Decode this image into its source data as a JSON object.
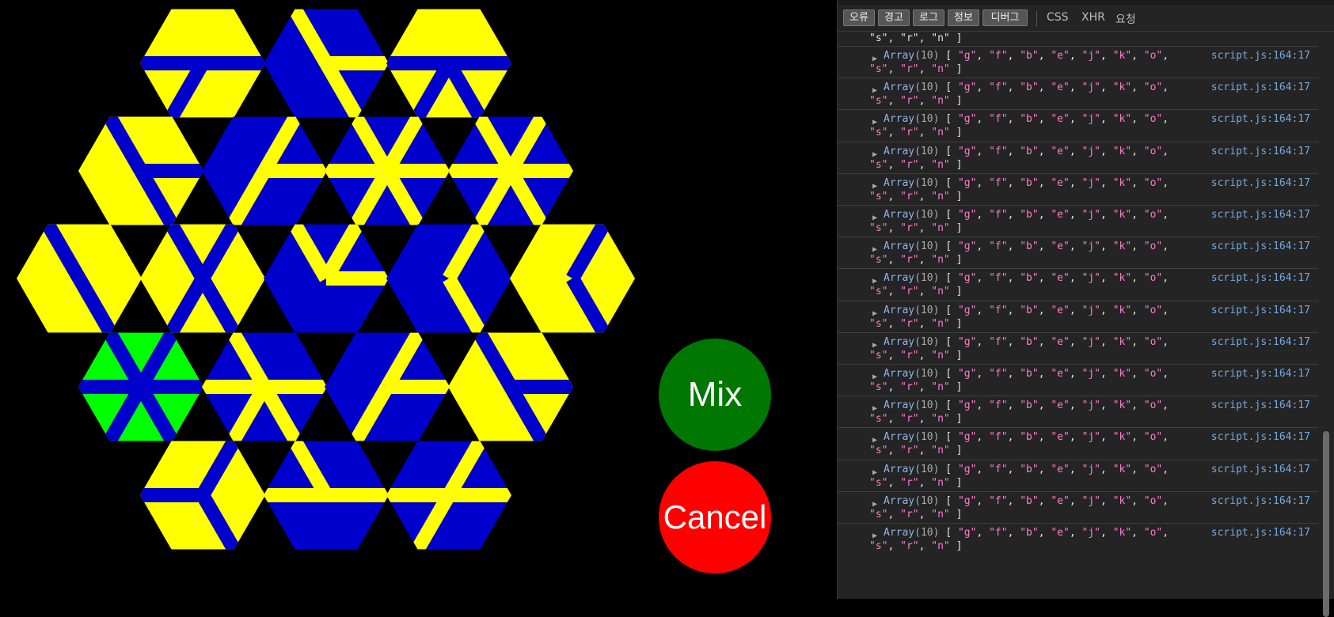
{
  "colors": {
    "background": "#000000",
    "yellow": "#ffff00",
    "blue": "#0000cc",
    "green": "#00ff00",
    "mix_button": "#007700",
    "cancel_button": "#ff0000"
  },
  "game": {
    "mix_label": "Mix",
    "cancel_label": "Cancel",
    "tiles": [
      {
        "id": "t1",
        "bg": "yellow",
        "fg": "blue",
        "arms": [
          1,
          3,
          4
        ]
      },
      {
        "id": "t2",
        "bg": "blue",
        "fg": "yellow",
        "arms": [
          1,
          2,
          5
        ]
      },
      {
        "id": "t3",
        "bg": "yellow",
        "fg": "blue",
        "arms": [
          1,
          2,
          3,
          4
        ]
      },
      {
        "id": "t4",
        "bg": "yellow",
        "fg": "blue",
        "arms": [
          1,
          2,
          5
        ]
      },
      {
        "id": "t5",
        "bg": "blue",
        "fg": "yellow",
        "arms": [
          0,
          1,
          3
        ]
      },
      {
        "id": "t6",
        "bg": "blue",
        "fg": "yellow",
        "arms": [
          0,
          1,
          2,
          3,
          4,
          5
        ]
      },
      {
        "id": "t7",
        "bg": "blue",
        "fg": "yellow",
        "arms": [
          0,
          1,
          2,
          3,
          4,
          5
        ]
      },
      {
        "id": "t8",
        "bg": "yellow",
        "fg": "blue",
        "arms": [
          2,
          5
        ]
      },
      {
        "id": "t9",
        "bg": "yellow",
        "fg": "blue",
        "arms": [
          0,
          2,
          3,
          5
        ]
      },
      {
        "id": "t10",
        "bg": "blue",
        "fg": "yellow",
        "arms": [
          0,
          1,
          5
        ]
      },
      {
        "id": "t11",
        "bg": "blue",
        "fg": "yellow",
        "arms": [
          0,
          2
        ]
      },
      {
        "id": "t12",
        "bg": "yellow",
        "fg": "blue",
        "arms": [
          0,
          2
        ]
      },
      {
        "id": "t13",
        "bg": "green",
        "fg": "blue",
        "arms": [
          0,
          1,
          2,
          3,
          4,
          5
        ]
      },
      {
        "id": "t14",
        "bg": "blue",
        "fg": "yellow",
        "arms": [
          1,
          2,
          3,
          4,
          5
        ]
      },
      {
        "id": "t15",
        "bg": "blue",
        "fg": "yellow",
        "arms": [
          0,
          1,
          3
        ]
      },
      {
        "id": "t16",
        "bg": "yellow",
        "fg": "blue",
        "arms": [
          1,
          2,
          5
        ]
      },
      {
        "id": "t17",
        "bg": "yellow",
        "fg": "blue",
        "arms": [
          0,
          2,
          4
        ]
      },
      {
        "id": "t18",
        "bg": "blue",
        "fg": "yellow",
        "arms": [
          1,
          4,
          5
        ]
      },
      {
        "id": "t19",
        "bg": "blue",
        "fg": "yellow",
        "arms": [
          0,
          1,
          3,
          4
        ]
      }
    ]
  },
  "devtools": {
    "filters": [
      {
        "label": "오류"
      },
      {
        "label": "경고"
      },
      {
        "label": "로그"
      },
      {
        "label": "정보"
      },
      {
        "label": "디버그"
      }
    ],
    "extra_filters": [
      "CSS",
      "XHR",
      "요청"
    ],
    "continuation": "\"s\", \"r\", \"n\" ]",
    "log_entries": [
      {
        "type": "Array",
        "length": "10",
        "items": [
          "g",
          "f",
          "b",
          "e",
          "j",
          "k",
          "o",
          "s",
          "r",
          "n"
        ],
        "source": "script.js:164:17"
      },
      {
        "type": "Array",
        "length": "10",
        "items": [
          "g",
          "f",
          "b",
          "e",
          "j",
          "k",
          "o",
          "s",
          "r",
          "n"
        ],
        "source": "script.js:164:17"
      },
      {
        "type": "Array",
        "length": "10",
        "items": [
          "g",
          "f",
          "b",
          "e",
          "j",
          "k",
          "o",
          "s",
          "r",
          "n"
        ],
        "source": "script.js:164:17"
      },
      {
        "type": "Array",
        "length": "10",
        "items": [
          "g",
          "f",
          "b",
          "e",
          "j",
          "k",
          "o",
          "s",
          "r",
          "n"
        ],
        "source": "script.js:164:17"
      },
      {
        "type": "Array",
        "length": "10",
        "items": [
          "g",
          "f",
          "b",
          "e",
          "j",
          "k",
          "o",
          "s",
          "r",
          "n"
        ],
        "source": "script.js:164:17"
      },
      {
        "type": "Array",
        "length": "10",
        "items": [
          "g",
          "f",
          "b",
          "e",
          "j",
          "k",
          "o",
          "s",
          "r",
          "n"
        ],
        "source": "script.js:164:17"
      },
      {
        "type": "Array",
        "length": "10",
        "items": [
          "g",
          "f",
          "b",
          "e",
          "j",
          "k",
          "o",
          "s",
          "r",
          "n"
        ],
        "source": "script.js:164:17"
      },
      {
        "type": "Array",
        "length": "10",
        "items": [
          "g",
          "f",
          "b",
          "e",
          "j",
          "k",
          "o",
          "s",
          "r",
          "n"
        ],
        "source": "script.js:164:17"
      },
      {
        "type": "Array",
        "length": "10",
        "items": [
          "g",
          "f",
          "b",
          "e",
          "j",
          "k",
          "o",
          "s",
          "r",
          "n"
        ],
        "source": "script.js:164:17"
      },
      {
        "type": "Array",
        "length": "10",
        "items": [
          "g",
          "f",
          "b",
          "e",
          "j",
          "k",
          "o",
          "s",
          "r",
          "n"
        ],
        "source": "script.js:164:17"
      },
      {
        "type": "Array",
        "length": "10",
        "items": [
          "g",
          "f",
          "b",
          "e",
          "j",
          "k",
          "o",
          "s",
          "r",
          "n"
        ],
        "source": "script.js:164:17"
      },
      {
        "type": "Array",
        "length": "10",
        "items": [
          "g",
          "f",
          "b",
          "e",
          "j",
          "k",
          "o",
          "s",
          "r",
          "n"
        ],
        "source": "script.js:164:17"
      },
      {
        "type": "Array",
        "length": "10",
        "items": [
          "g",
          "f",
          "b",
          "e",
          "j",
          "k",
          "o",
          "s",
          "r",
          "n"
        ],
        "source": "script.js:164:17"
      },
      {
        "type": "Array",
        "length": "10",
        "items": [
          "g",
          "f",
          "b",
          "e",
          "j",
          "k",
          "o",
          "s",
          "r",
          "n"
        ],
        "source": "script.js:164:17"
      },
      {
        "type": "Array",
        "length": "10",
        "items": [
          "g",
          "f",
          "b",
          "e",
          "j",
          "k",
          "o",
          "s",
          "r",
          "n"
        ],
        "source": "script.js:164:17"
      },
      {
        "type": "Array",
        "length": "10",
        "items": [
          "g",
          "f",
          "b",
          "e",
          "j",
          "k",
          "o",
          "s",
          "r",
          "n"
        ],
        "source": "script.js:164:17"
      }
    ]
  }
}
